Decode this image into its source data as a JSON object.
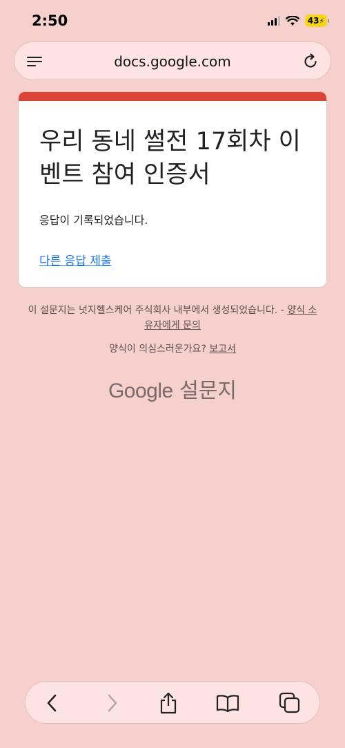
{
  "status_bar": {
    "time": "2:50",
    "battery_level": "43"
  },
  "browser": {
    "url": "docs.google.com",
    "icons": [
      "menu-icon",
      "reload-icon"
    ]
  },
  "form_card": {
    "accent_color": "#db4437",
    "title": "우리 동네 썰전 17회차 이벤트 참여 인증서",
    "message": "응답이 기록되었습니다.",
    "submit_another_link": "다른 응답 제출"
  },
  "footer": {
    "disclaimer_text": "이 설문지는 넛지헬스케어 주식회사 내부에서 생성되었습니다. - ",
    "contact_owner_link": "양식 소유자에게 문의",
    "abuse_question": "양식이 의심스러운가요? ",
    "report_link": "보고서",
    "brand_google": "Google",
    "brand_forms": "설문지"
  },
  "bottom_toolbar": {
    "icons": [
      "back-icon",
      "forward-icon",
      "share-icon",
      "bookmarks-icon",
      "tabs-icon"
    ]
  }
}
